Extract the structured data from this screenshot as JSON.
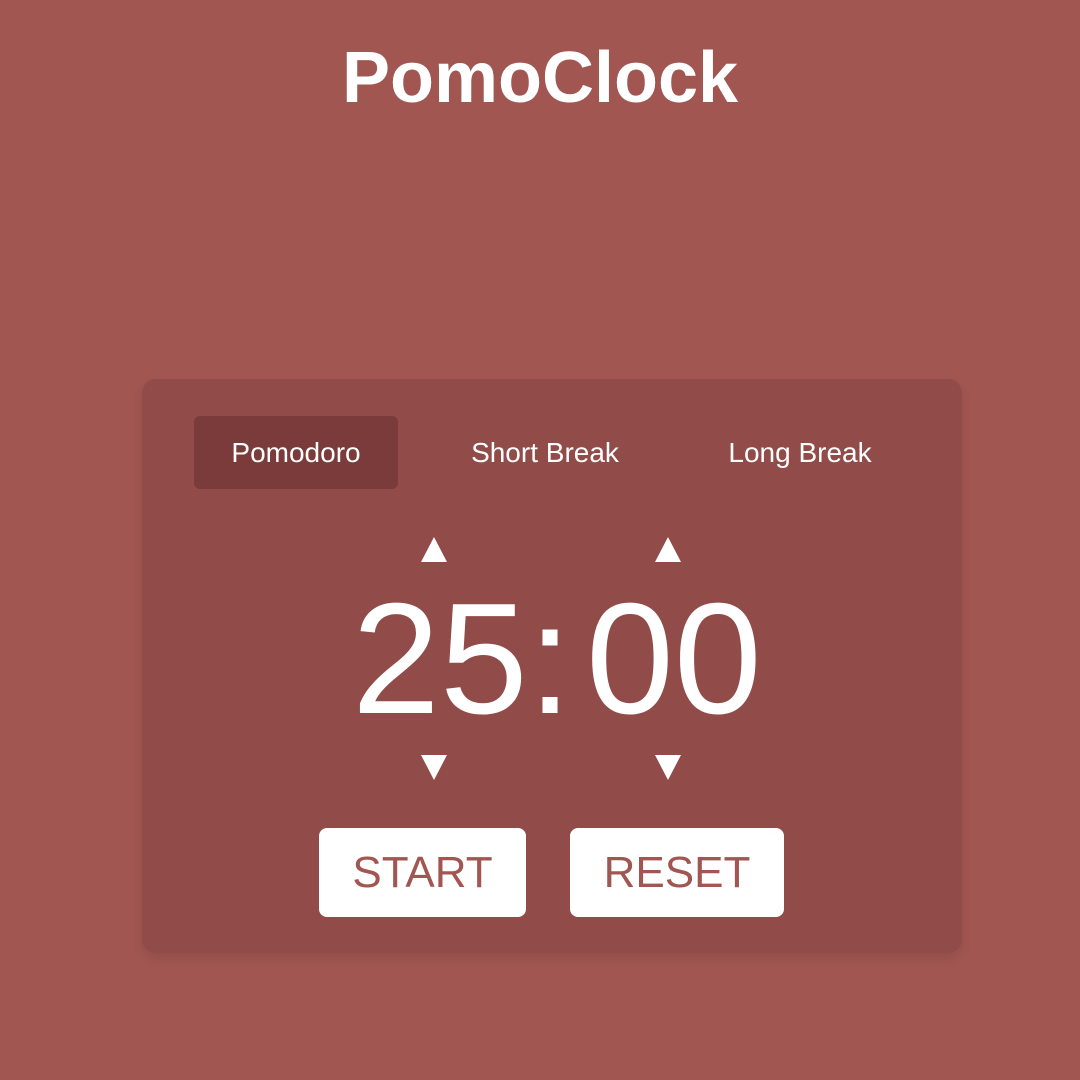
{
  "app": {
    "title": "PomoClock"
  },
  "tabs": [
    {
      "label": "Pomodoro",
      "active": true
    },
    {
      "label": "Short Break",
      "active": false
    },
    {
      "label": "Long Break",
      "active": false
    }
  ],
  "timer": {
    "minutes": "25",
    "separator": ":",
    "seconds": "00"
  },
  "controls": {
    "increment_icon": "triangle-up-icon",
    "decrement_icon": "triangle-down-icon",
    "start_label": "START",
    "reset_label": "RESET"
  },
  "colors": {
    "background": "#a15651",
    "card": "#914b48",
    "active_tab": "#7a3b3a",
    "text": "#ffffff",
    "button_text": "#a15651"
  }
}
